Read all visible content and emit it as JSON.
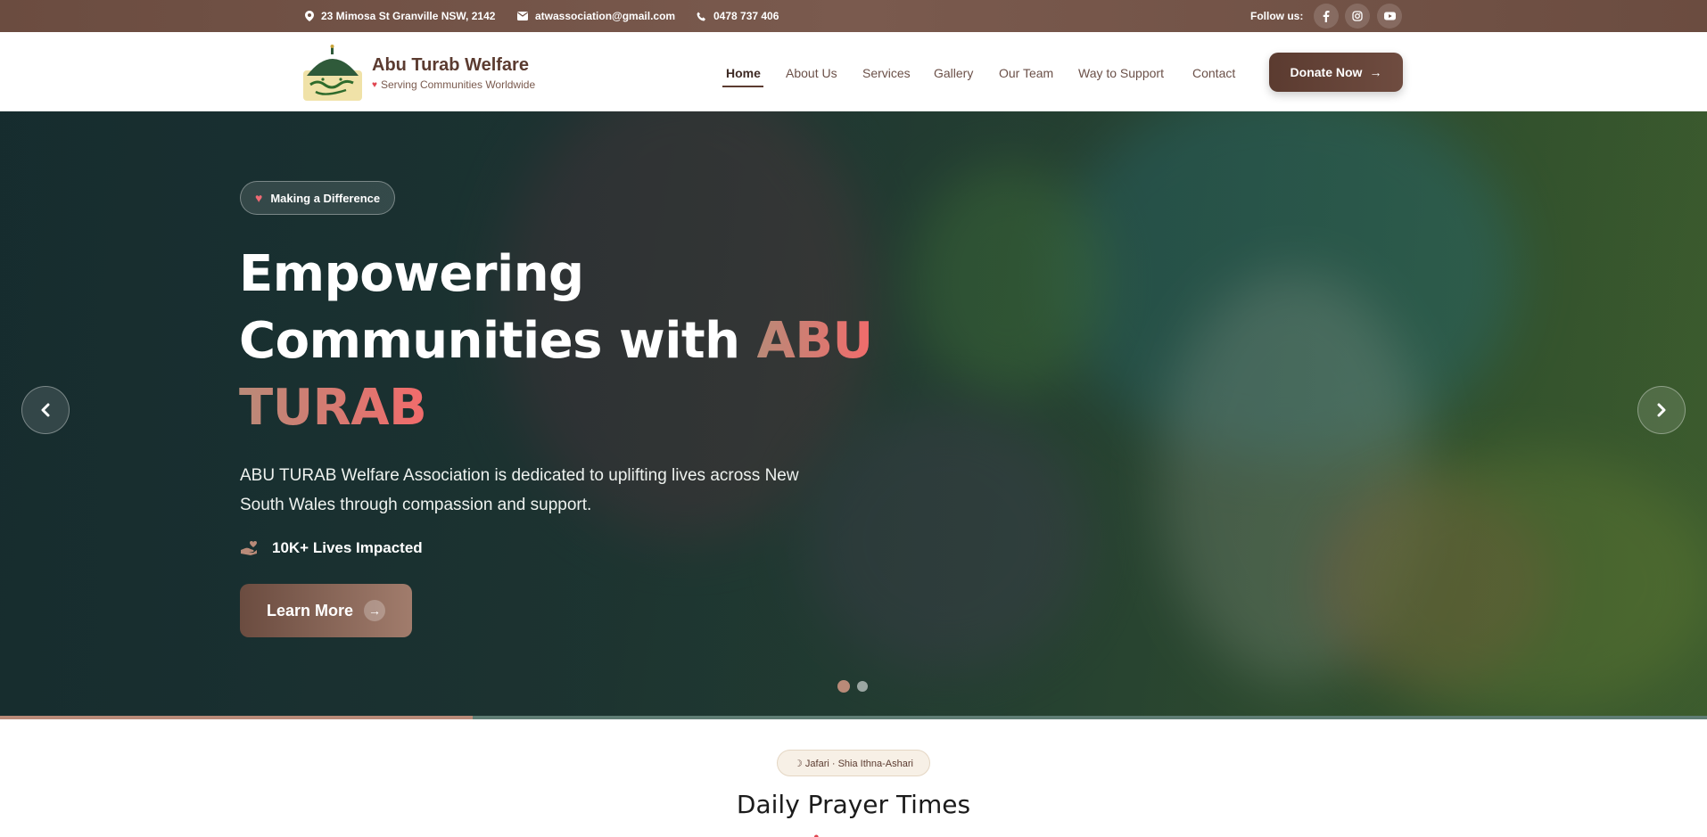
{
  "topbar": {
    "address": "23 Mimosa St Granville NSW, 2142",
    "email": "atwassociation@gmail.com",
    "phone": "0478 737 406",
    "follow_label": "Follow us:",
    "socials": [
      "facebook-icon",
      "instagram-icon",
      "youtube-icon"
    ]
  },
  "header": {
    "brand_name": "Abu Turab Welfare",
    "brand_tagline": "Serving Communities Worldwide",
    "nav": [
      {
        "label": "Home",
        "active": true
      },
      {
        "label": "About Us",
        "active": false
      },
      {
        "label": "Services",
        "active": false
      },
      {
        "label": "Gallery",
        "active": false
      },
      {
        "label": "Our Team",
        "active": false
      },
      {
        "label": "Way to Support",
        "active": false
      },
      {
        "label": "Contact",
        "active": false
      }
    ],
    "donate_label": "Donate Now"
  },
  "hero": {
    "badge": "Making a Difference",
    "headline_line1": "Empowering",
    "headline_line2_plain": "Communities with ",
    "headline_accent_1": "ABU",
    "headline_accent_2": "TURAB",
    "description": "ABU TURAB Welfare Association is dedicated to uplifting lives across New South Wales through compassion and support.",
    "stat": "10K+ Lives Impacted",
    "cta_label": "Learn More",
    "slide_count": 2,
    "active_slide": 1,
    "slide_progress": 0.277
  },
  "prayer": {
    "badge": "☽ Jafari · Shia Ithna-Ashari",
    "title": "Daily Prayer Times"
  },
  "colors": {
    "brand_brown": "#5b3b30",
    "accent_coral": "#f26b6b",
    "hero_teal": "#1e3a3c"
  }
}
